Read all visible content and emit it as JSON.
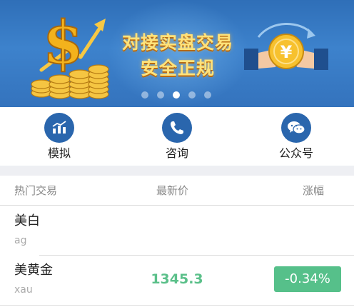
{
  "banner": {
    "headline_line1": "对接实盘交易",
    "headline_line2": "安全正规",
    "slide_count": 5,
    "active_slide_index": 2,
    "icons": [
      "dollar-coins-icon",
      "hand-coin-exchange-icon"
    ]
  },
  "quick_nav": [
    {
      "label": "模拟",
      "icon": "chart-icon"
    },
    {
      "label": "咨询",
      "icon": "phone-icon"
    },
    {
      "label": "公众号",
      "icon": "wechat-icon"
    }
  ],
  "table": {
    "headers": {
      "name": "热门交易",
      "price": "最新价",
      "change": "涨幅"
    },
    "rows": [
      {
        "name": "美白",
        "code": "ag",
        "price": "",
        "change": ""
      },
      {
        "name": "美黄金",
        "code": "xau",
        "price": "1345.3",
        "change": "-0.34%"
      }
    ]
  },
  "colors": {
    "banner_blue": "#3473bd",
    "icon_blue": "#2a66ad",
    "headline_gold": "#ffe27a",
    "change_green": "#56c08a",
    "price_green": "#5bc08a"
  }
}
